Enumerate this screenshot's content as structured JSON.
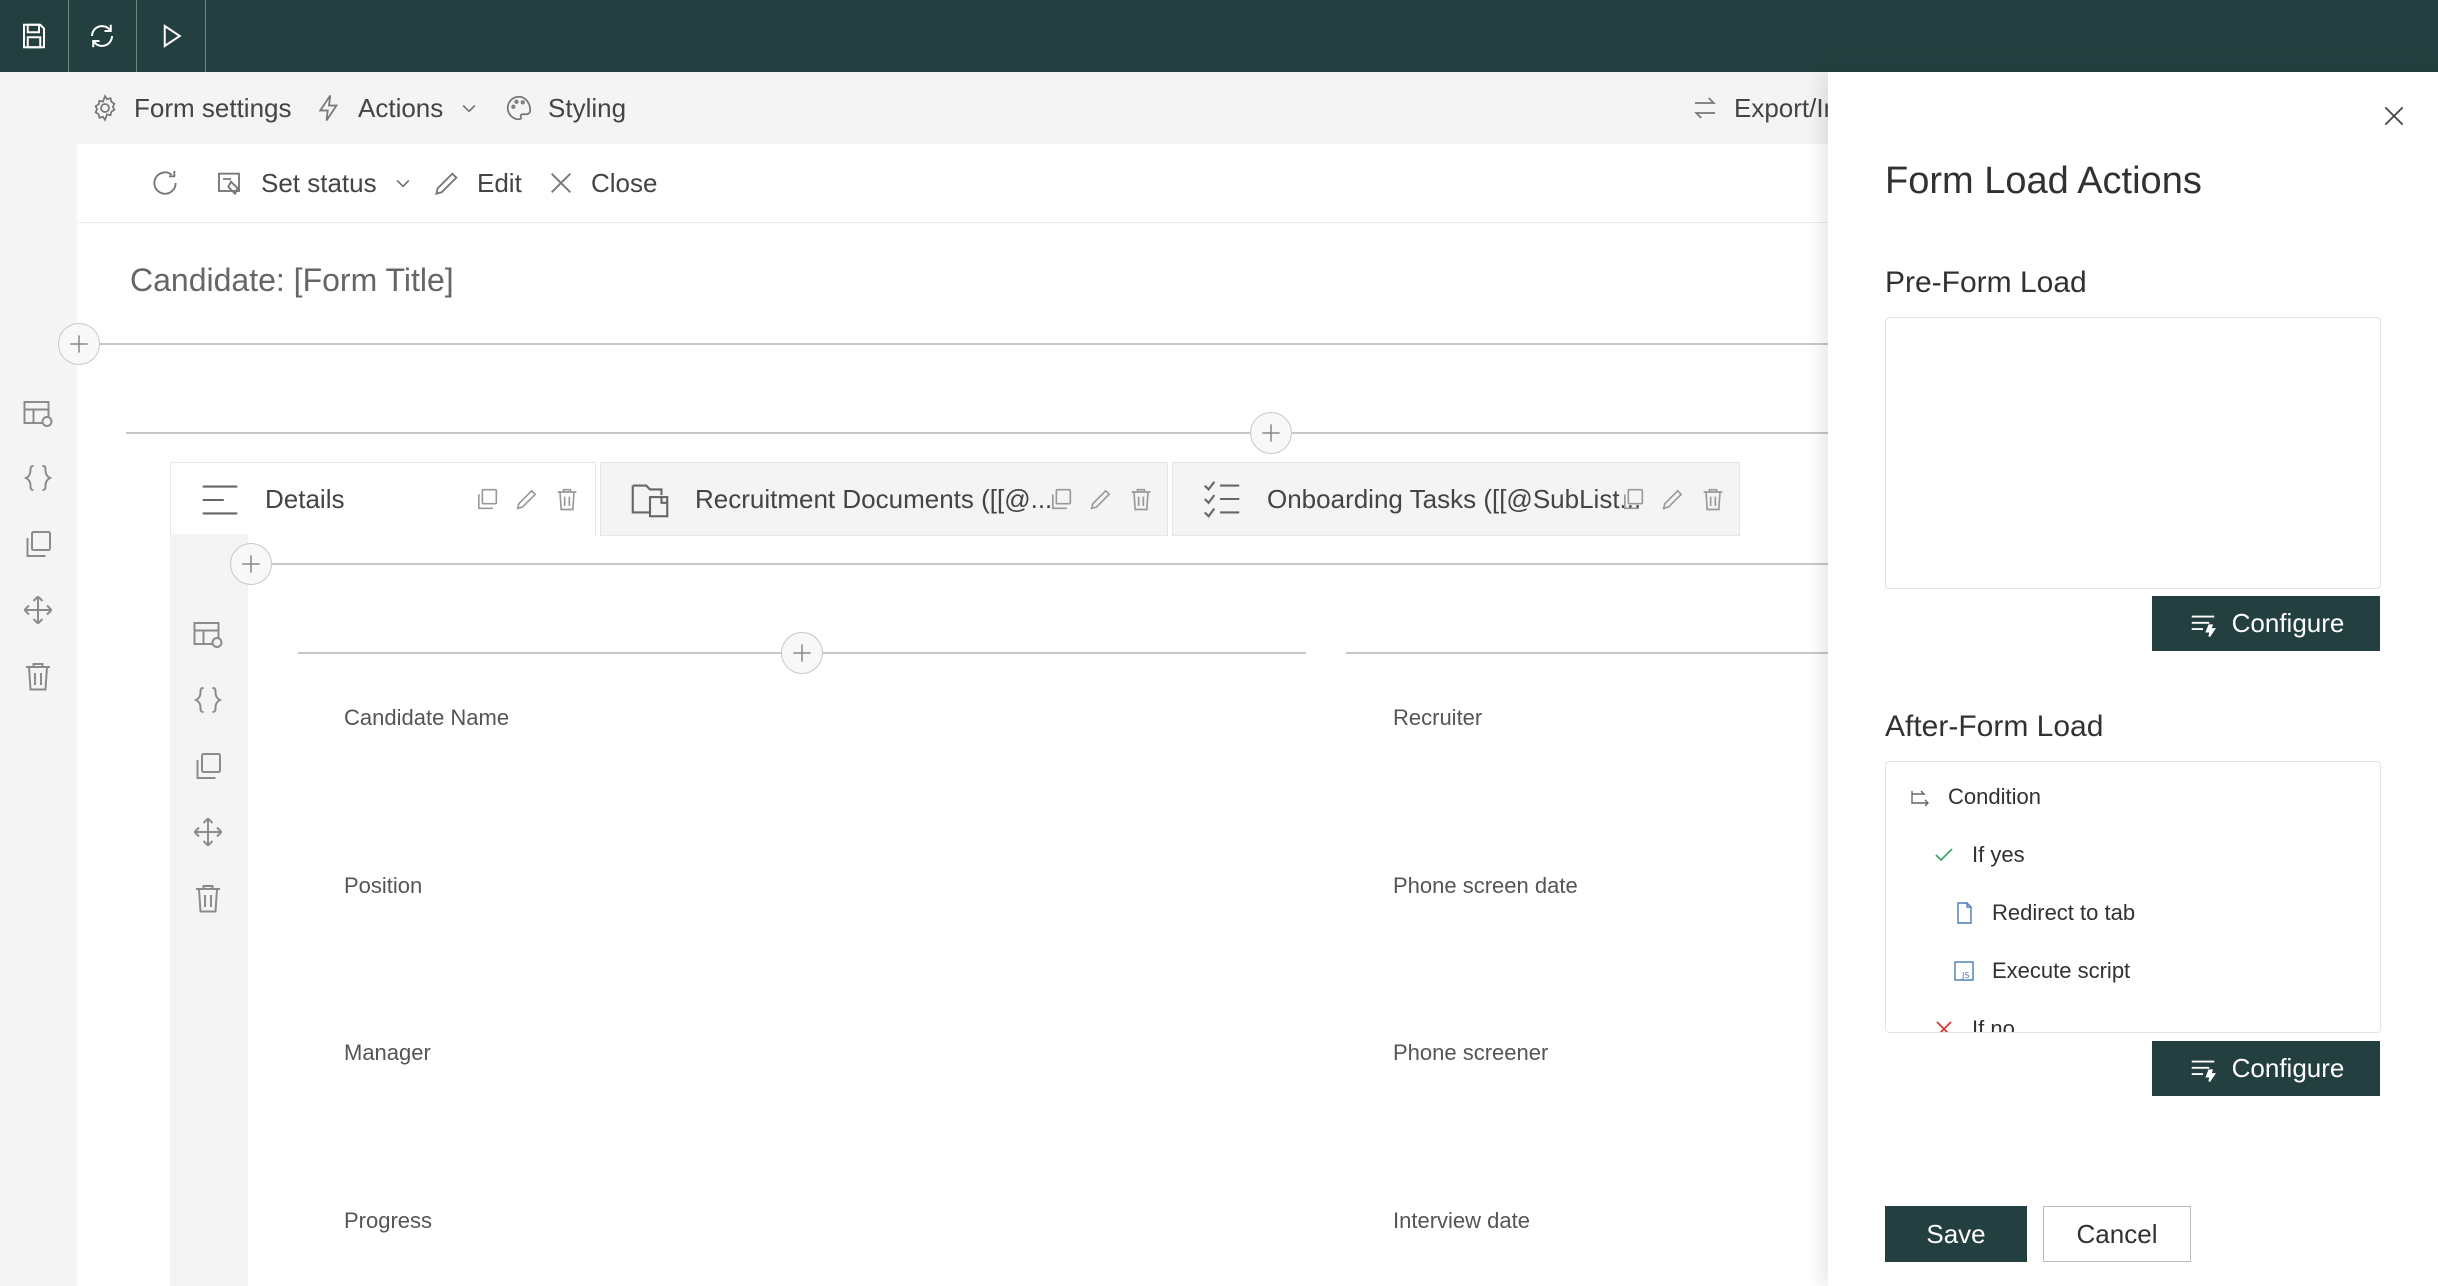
{
  "command_bar": {
    "form_settings": "Form settings",
    "actions": "Actions",
    "styling": "Styling",
    "export_import": "Export/Im"
  },
  "form_toolbar": {
    "set_status": "Set status",
    "edit": "Edit",
    "close": "Close"
  },
  "form": {
    "title": "Candidate: [Form Title]",
    "tabs": [
      {
        "label": "Details"
      },
      {
        "label": "Recruitment Documents ([[@..."
      },
      {
        "label": "Onboarding Tasks ([[@SubList..."
      }
    ],
    "fields_left": [
      "Candidate Name",
      "Position",
      "Manager",
      "Progress"
    ],
    "fields_right": [
      "Recruiter",
      "Phone screen date",
      "Phone screener",
      "Interview date"
    ]
  },
  "panel": {
    "title": "Form Load Actions",
    "pre_title": "Pre-Form Load",
    "after_title": "After-Form Load",
    "configure": "Configure",
    "tree": {
      "condition": "Condition",
      "if_yes": "If yes",
      "redirect": "Redirect to tab",
      "execute": "Execute script",
      "if_no": "If no"
    },
    "save": "Save",
    "cancel": "Cancel"
  },
  "colors": {
    "topbar": "#243f3f",
    "primary_button": "#243f3f",
    "check_green": "#3fa66b",
    "cross_red": "#d83b3b",
    "icon_blue": "#4a7ab8"
  }
}
